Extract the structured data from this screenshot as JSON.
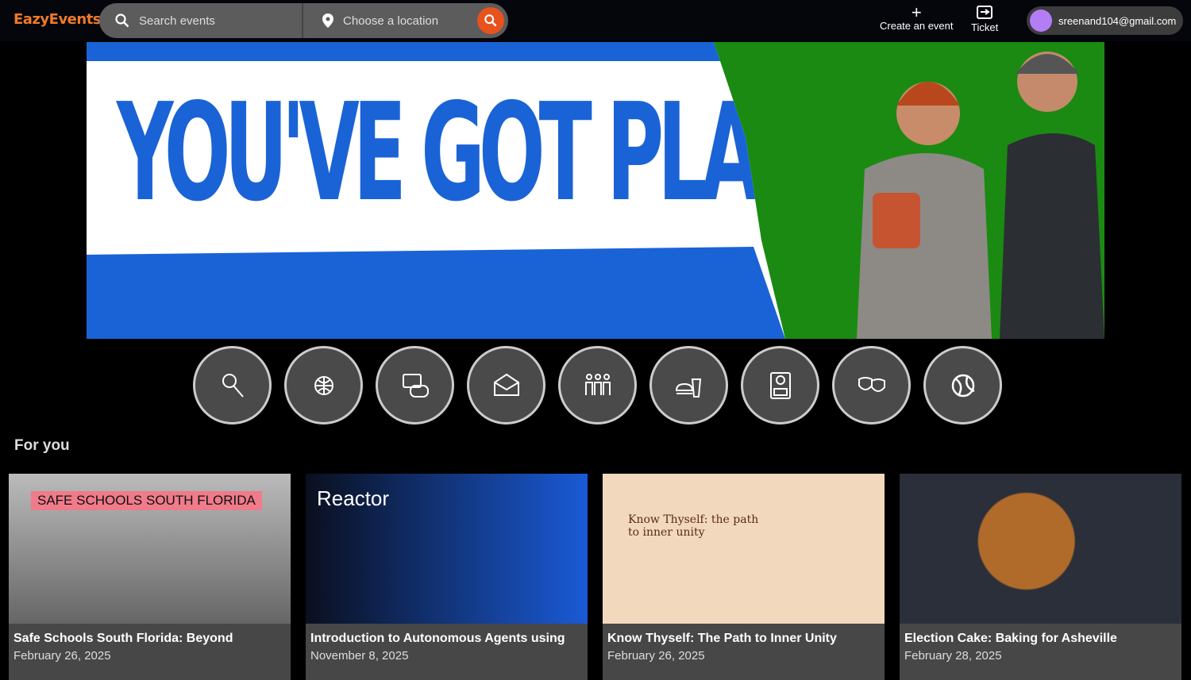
{
  "header": {
    "logo": "EazyEvents",
    "search_placeholder": "Search events",
    "location_placeholder": "Choose a location",
    "create_label": "Create an event",
    "ticket_label": "Ticket",
    "user_email": "sreenand104@gmail.com",
    "accent": "#e8521c"
  },
  "banner": {
    "headline": "YOU'VE GOT PLANS"
  },
  "categories": [
    "music",
    "travel",
    "gaming",
    "business",
    "community",
    "food-drink",
    "education",
    "arts-theatre",
    "sports"
  ],
  "section_title": "For you",
  "events": [
    {
      "title": "Safe Schools South Florida: Beyond",
      "date": "February 26, 2025",
      "thumb_text": "SAFE SCHOOLS SOUTH FLORIDA",
      "thumb_bg": "#8a8a8a"
    },
    {
      "title": "Introduction to Autonomous Agents using",
      "date": "November 8, 2025",
      "thumb_text": "Reactor",
      "thumb_bg": "#0d1a33"
    },
    {
      "title": "Know Thyself: The Path to Inner Unity",
      "date": "February 26, 2025",
      "thumb_text": "Know Thyself: the path to inner unity",
      "thumb_bg": "#f2d9be"
    },
    {
      "title": "Election Cake: Baking for Asheville",
      "date": "February 28, 2025",
      "thumb_text": "",
      "thumb_bg": "#2a2f3a"
    }
  ]
}
